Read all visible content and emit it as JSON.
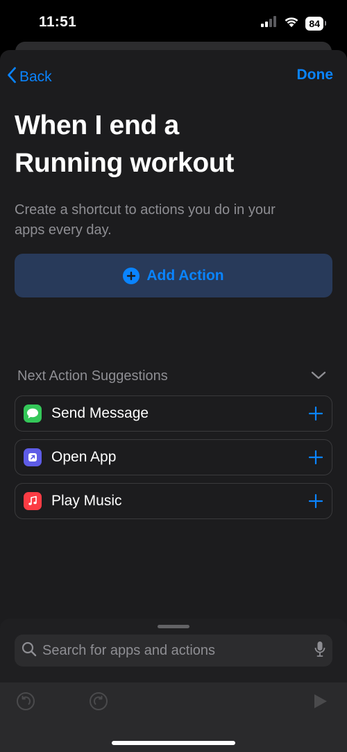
{
  "status": {
    "time": "11:51",
    "battery": "84"
  },
  "nav": {
    "back_label": "Back",
    "done_label": "Done"
  },
  "header": {
    "title_line1": "When I end a",
    "title_line2": "Running workout",
    "subtitle_line1": "Create a shortcut to actions you do in your",
    "subtitle_line2": "apps every day."
  },
  "add_action": {
    "label": "Add Action"
  },
  "suggestions": {
    "header": "Next Action Suggestions",
    "items": [
      {
        "label": "Send Message",
        "icon": "messages-icon",
        "color": "#34c759"
      },
      {
        "label": "Open App",
        "icon": "open-app-icon",
        "color": "#5e5ce6"
      },
      {
        "label": "Play Music",
        "icon": "music-icon",
        "color": "#fc3c44"
      }
    ]
  },
  "search": {
    "placeholder": "Search for apps and actions"
  },
  "colors": {
    "accent": "#0a84ff",
    "background": "#1c1c1e"
  }
}
